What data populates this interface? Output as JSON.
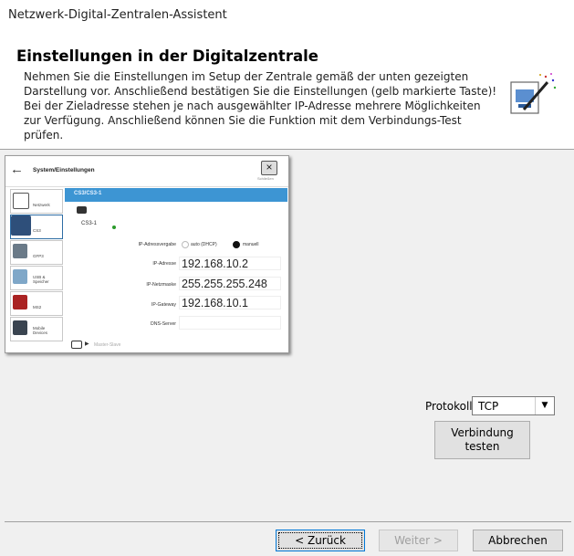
{
  "window": {
    "title": "Netzwerk-Digital-Zentralen-Assistent"
  },
  "header": {
    "title": "Einstellungen in der Digitalzentrale",
    "body": "Nehmen Sie die Einstellungen im Setup der Zentrale gemäß der unten gezeigten Darstellung vor. Anschließend bestätigen Sie die Einstellungen (gelb markierte Taste)! Bei der Zieladresse stehen je nach ausgewählter IP-Adresse mehrere Möglichkeiten zur Verfügung. Anschließend können Sie die Funktion mit dem Verbindungs-Test prüfen."
  },
  "screenshot": {
    "title": "System/Einstellungen",
    "close_label": "Schließen",
    "sidebar": [
      {
        "label": "Netzwerk",
        "icon": "network-icon"
      },
      {
        "label": "CS3",
        "icon": "cs3-icon"
      },
      {
        "label": "GFP3",
        "icon": "gfp3-icon"
      },
      {
        "label": "USB & Speicher",
        "icon": "usb-icon"
      },
      {
        "label": "MS2",
        "icon": "ms2-icon"
      },
      {
        "label": "Mobile Devices",
        "icon": "mobile-icon"
      }
    ],
    "section_bar": "CS3/CS3-1",
    "device_label": "CS3-1",
    "ip_mode_label": "IP-Adressvergabe",
    "ip_mode_auto": "auto (DHCP)",
    "ip_mode_manual": "manuell",
    "ip_address_label": "IP-Adresse",
    "ip_address": "192.168.10.2",
    "netmask_label": "IP-Netzmaske",
    "netmask": "255.255.255.248",
    "gateway_label": "IP-Gateway",
    "gateway": "192.168.10.1",
    "dns_label": "DNS-Server",
    "dns": "",
    "master_slave": "Master-Slave"
  },
  "protocol": {
    "label": "Protokoll:",
    "value": "TCP"
  },
  "test_button": {
    "line1": "Verbindung",
    "line2": "testen"
  },
  "footer": {
    "back": "< Zurück",
    "next": "Weiter >",
    "cancel": "Abbrechen"
  },
  "colors": {
    "accent": "#3d95d3",
    "focus": "#0078d7"
  }
}
